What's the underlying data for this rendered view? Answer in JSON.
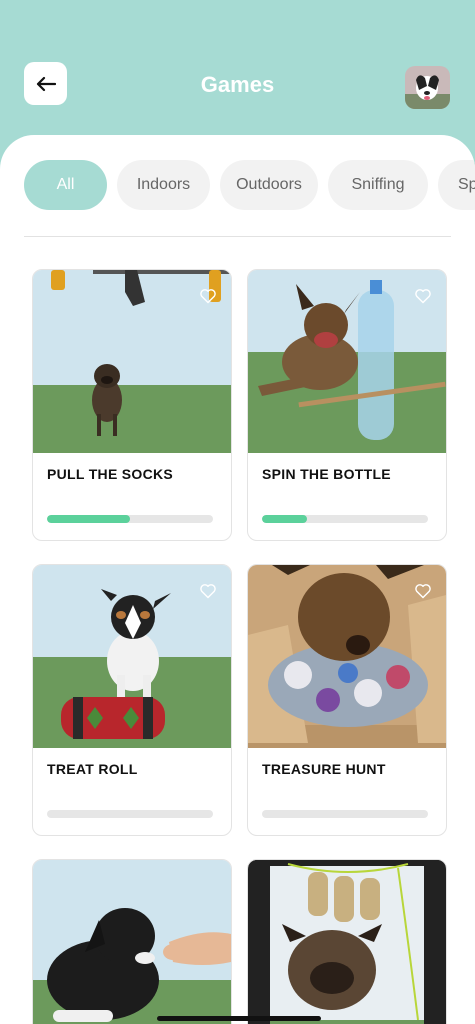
{
  "header": {
    "title": "Games",
    "back_icon": "arrow-left-icon",
    "avatar_icon": "dog-avatar"
  },
  "filters": [
    {
      "label": "All",
      "active": true
    },
    {
      "label": "Indoors",
      "active": false
    },
    {
      "label": "Outdoors",
      "active": false
    },
    {
      "label": "Sniffing",
      "active": false
    },
    {
      "label": "Sp",
      "active": false
    }
  ],
  "games": [
    {
      "title": "PULL THE SOCKS",
      "progress": 0.5,
      "favorite_icon": "heart-outline-icon"
    },
    {
      "title": "SPIN THE BOTTLE",
      "progress": 0.27,
      "favorite_icon": "heart-outline-icon"
    },
    {
      "title": "TREAT ROLL",
      "progress": 0,
      "favorite_icon": "heart-outline-icon"
    },
    {
      "title": "TREASURE HUNT",
      "progress": 0,
      "favorite_icon": "heart-outline-icon"
    },
    {
      "title": "",
      "progress": 0,
      "favorite_icon": ""
    },
    {
      "title": "",
      "progress": 0,
      "favorite_icon": ""
    }
  ],
  "colors": {
    "accent": "#a6dbd3",
    "progress": "#5bd19b",
    "track": "#e6e6e6",
    "chip": "#f2f2f2"
  }
}
